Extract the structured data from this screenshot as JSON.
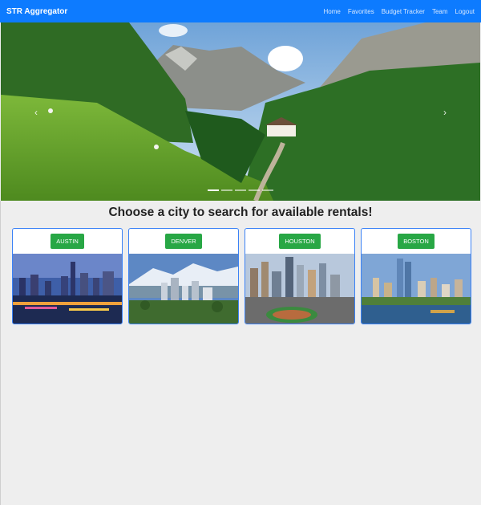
{
  "navbar": {
    "brand": "STR Aggregator",
    "links": [
      "Home",
      "Favorites",
      "Budget Tracker",
      "Team",
      "Logout"
    ]
  },
  "carousel": {
    "prev_icon": "chevron-left-icon",
    "next_icon": "chevron-right-icon",
    "prev_glyph": "‹",
    "next_glyph": "›",
    "slide_count": 5,
    "active_slide": 1
  },
  "main": {
    "heading": "Choose a city to search for available rentals!"
  },
  "cities": [
    {
      "label": "AUSTIN"
    },
    {
      "label": "DENVER"
    },
    {
      "label": "HOUSTON"
    },
    {
      "label": "BOSTON"
    }
  ],
  "colors": {
    "navbar": "#0d7bff",
    "city_button": "#28a745",
    "card_border": "#3b82f6",
    "page_background": "#eeeeee"
  }
}
